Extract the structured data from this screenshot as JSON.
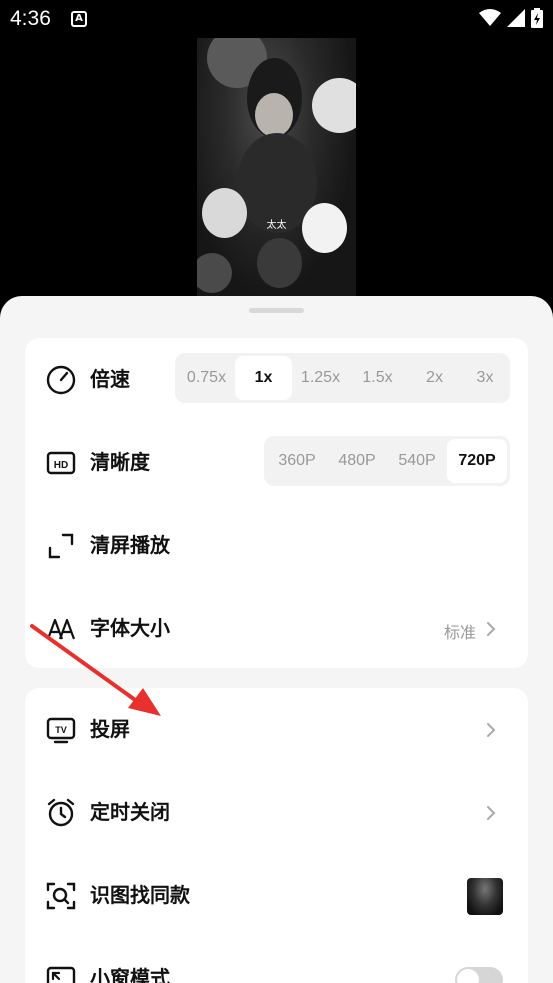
{
  "status": {
    "time": "4:36",
    "a_icon": "A"
  },
  "video": {
    "subtitle": "太太"
  },
  "settings": {
    "speed": {
      "label": "倍速",
      "options": [
        "0.75x",
        "1x",
        "1.25x",
        "1.5x",
        "2x",
        "3x"
      ],
      "selected": "1x"
    },
    "quality": {
      "label": "清晰度",
      "options": [
        "360P",
        "480P",
        "540P",
        "720P"
      ],
      "selected": "720P"
    },
    "clear_screen": {
      "label": "清屏播放"
    },
    "font_size": {
      "label": "字体大小",
      "value": "标准"
    }
  },
  "more": {
    "cast": {
      "label": "投屏"
    },
    "timer": {
      "label": "定时关闭"
    },
    "image_search": {
      "label": "识图找同款"
    },
    "mini_window": {
      "label": "小窗模式",
      "enabled": false
    }
  },
  "colors": {
    "annotation_arrow": "#e8302c",
    "sheet_bg": "#f5f5f5",
    "card_bg": "#ffffff"
  },
  "icons": [
    "speed-gauge-icon",
    "hd-icon",
    "fullscreen-corners-icon",
    "font-size-icon",
    "tv-cast-icon",
    "alarm-clock-icon",
    "scan-image-icon",
    "mini-window-icon",
    "chevron-right-icon"
  ]
}
